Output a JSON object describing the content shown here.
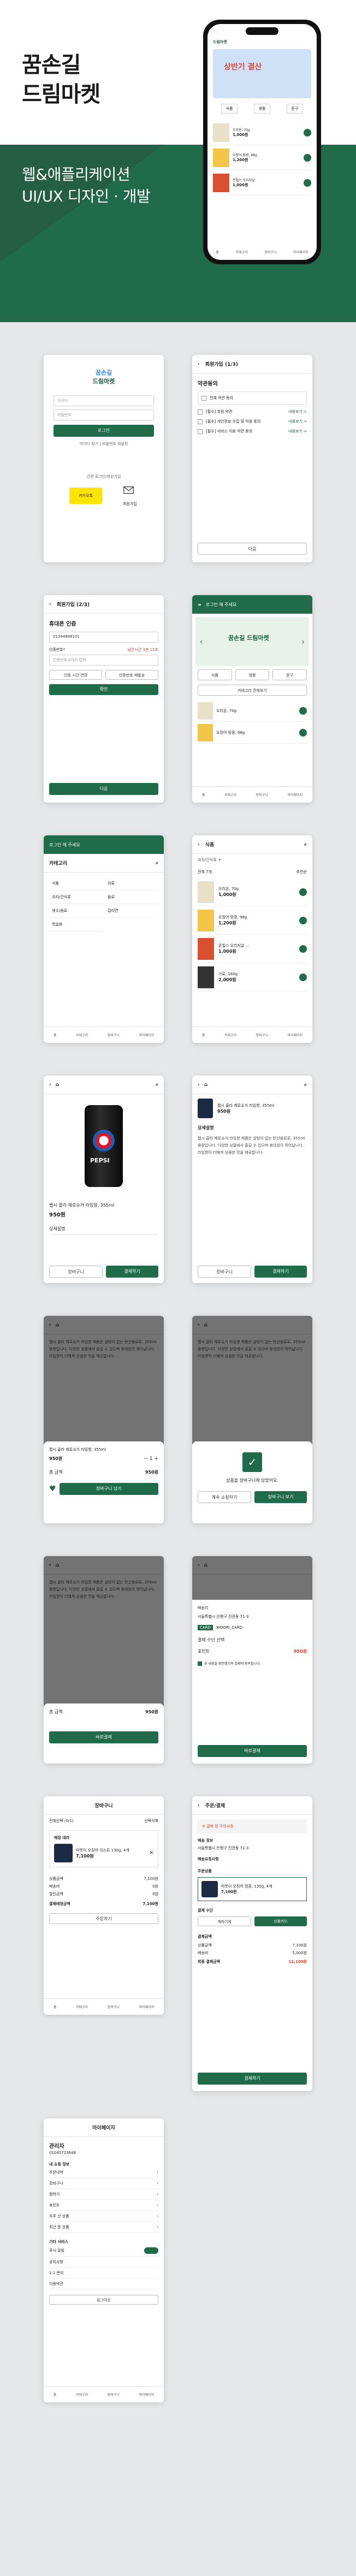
{
  "hero": {
    "title_line1": "꿈손길",
    "title_line2": "드림마켓",
    "subtitle_line1": "웹&애플리케이션",
    "subtitle_line2": "UI/UX 디자인 · 개발"
  },
  "brand": {
    "name_line1": "꿈손길",
    "name_line2": "드림마켓",
    "accent": "#1f6b4a"
  },
  "login": {
    "id_placeholder": "아이디",
    "pw_placeholder": "비밀번호",
    "login_btn": "로그인",
    "find_links": "아이디 찾기 | 비밀번호 재설정",
    "easy_login": "간편 로그인/회원가입",
    "kakao": "카카오톡",
    "signup": "회원가입"
  },
  "terms": {
    "header": "회원가입 (1/3)",
    "title": "약관동의",
    "all": "전체 약관 동의",
    "item1": "[필수] 회원 약관",
    "item2": "[필수] 개인정보 수집 및 이용 동의",
    "item3": "[필수] 서비스 이용 약관 동의",
    "view": "내용보기 >",
    "next": "다음"
  },
  "verify": {
    "header": "회원가입 (2/3)",
    "title": "휴대폰 인증",
    "phone_value": "01094886101",
    "code_label": "인증번호*",
    "code_hint": "남은시간 3분 15초",
    "code_placeholder": "인증번호 6자리 입력",
    "resend": "인증 시간 연장",
    "request": "인증번호 재발송",
    "confirm": "확인",
    "next": "다음"
  },
  "home": {
    "header": "로그인 해 주세요",
    "banner": "꿈손길 드림마켓",
    "tabs": [
      "식품",
      "생활",
      "문구"
    ],
    "more": "카테고리 전체보기"
  },
  "category": {
    "header": "카테고리",
    "items": [
      "식품",
      "의류",
      "과자/간식류",
      "음료",
      "생수/음료",
      "컵라면",
      "학습용"
    ]
  },
  "list": {
    "title": "식품",
    "filter": "과자/간식류",
    "count": "전체 7개",
    "sort": "추천순",
    "products": [
      {
        "name": "오리온, 70g",
        "price": "1,000원"
      },
      {
        "name": "오징어 땅콩, 98g",
        "price": "1,200원"
      },
      {
        "name": "존칩스 오리지날 ...",
        "price": "1,000원"
      },
      {
        "name": "가로, 160g",
        "price": "2,000원"
      }
    ]
  },
  "detail": {
    "product": "펩시 콜라 제로슈거 라임향, 355ml",
    "price": "950원",
    "info_tab": "상세설명",
    "desc": "펩시 콜라 제로슈거 라임향 제품은 설탕이 없는 탄산음료로, 355ml 용량입니다. 다양한 상황에서 즐길 수 있으며 휴대성이 뛰어납니다. 라임향이 더해져 상큼한 맛을 제공합니다.",
    "cart": "장바구니",
    "buy": "결제하기"
  },
  "sheet": {
    "option": "펩시 콜라 제로슈거 라임향, 355ml",
    "price": "950원",
    "qty": "1",
    "total_label": "총 금액",
    "total": "950원",
    "add_cart": "장바구니 담기",
    "added": "상품을 장바구니에 담았어요.",
    "go_cart": "장바구니 보기",
    "continue": "계속 쇼핑하기"
  },
  "order_sheet": {
    "recipient": "배송지",
    "card_label": "WOORI_CARD",
    "pay_label": "결제 수단 선택",
    "point": "포인트",
    "final": "950원",
    "agree": "위 내용을 확인했으며 결제에 동의합니다.",
    "pay_btn": "바로결제"
  },
  "cart": {
    "header": "장바구니",
    "select_all": "전체선택 (0/1)",
    "delete": "선택삭제",
    "store": "매장 대리",
    "item": "따뜻이 오징어 이스트 130g, 4개",
    "item_price": "7,100원",
    "summary": [
      [
        "상품금액",
        "7,100원"
      ],
      [
        "배송비",
        "0원"
      ],
      [
        "할인금액",
        "0원"
      ]
    ],
    "total_label": "결제예정금액",
    "total": "7,100원",
    "order_btn": "주문하기"
  },
  "checkout": {
    "header": "주문/결제",
    "notice": "※ 결제 전 주의사항",
    "addr_label": "배송 정보",
    "addr": "서울특별시 은평구 진관동 71-3",
    "req": "배송요청사항",
    "items_label": "주문상품",
    "item": "따뜻이 오징어 땅콩, 130g, 4개",
    "item_price": "7,100원",
    "pay_method": "결제 수단",
    "m1": "계좌이체",
    "m2": "신용카드",
    "price_label": "결제금액",
    "sum": [
      [
        "상품금액",
        "7,100원"
      ],
      [
        "배송비",
        "5,000원"
      ]
    ],
    "total_label": "최종 결제금액",
    "total": "12,100원",
    "pay_btn": "결제하기"
  },
  "mypage": {
    "header": "마이페이지",
    "user": "관리자",
    "phone": "01045723648",
    "section1": "내 쇼핑 정보",
    "items": [
      "주문내역",
      "장바구니",
      "찜하기",
      "포인트",
      "자주 산 상품",
      "최근 본 상품"
    ],
    "section2": "기타 서비스",
    "toggle_label": "푸시 알림",
    "etc": [
      "공지사항",
      "1:1 문의",
      "이용약관",
      "로그아웃"
    ]
  },
  "navbar": [
    "홈",
    "카테고리",
    "장바구니",
    "마이페이지"
  ]
}
